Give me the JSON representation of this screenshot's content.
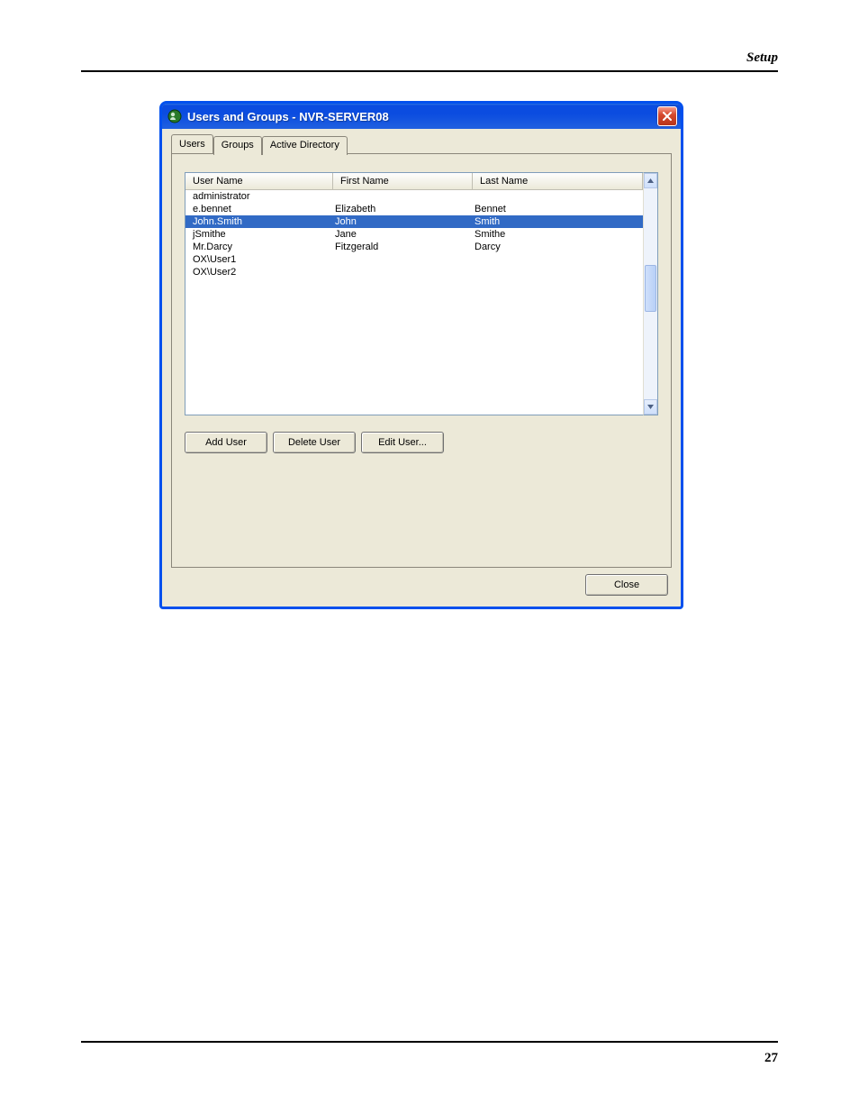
{
  "page": {
    "section_title": "Setup",
    "page_number": "27"
  },
  "window": {
    "title": "Users and Groups - NVR-SERVER08",
    "tabs": [
      "Users",
      "Groups",
      "Active Directory"
    ],
    "active_tab_index": 0,
    "columns": {
      "username": "User Name",
      "firstname": "First Name",
      "lastname": "Last Name"
    },
    "rows": [
      {
        "username": "administrator",
        "firstname": "",
        "lastname": "",
        "selected": false
      },
      {
        "username": "e.bennet",
        "firstname": "Elizabeth",
        "lastname": "Bennet",
        "selected": false
      },
      {
        "username": "John.Smith",
        "firstname": "John",
        "lastname": "Smith",
        "selected": true
      },
      {
        "username": "jSmithe",
        "firstname": "Jane",
        "lastname": "Smithe",
        "selected": false
      },
      {
        "username": "Mr.Darcy",
        "firstname": "Fitzgerald",
        "lastname": "Darcy",
        "selected": false
      },
      {
        "username": "OX\\User1",
        "firstname": "",
        "lastname": "",
        "selected": false
      },
      {
        "username": "OX\\User2",
        "firstname": "",
        "lastname": "",
        "selected": false
      }
    ],
    "buttons": {
      "add": "Add User",
      "delete": "Delete User",
      "edit": "Edit User...",
      "close": "Close"
    }
  }
}
